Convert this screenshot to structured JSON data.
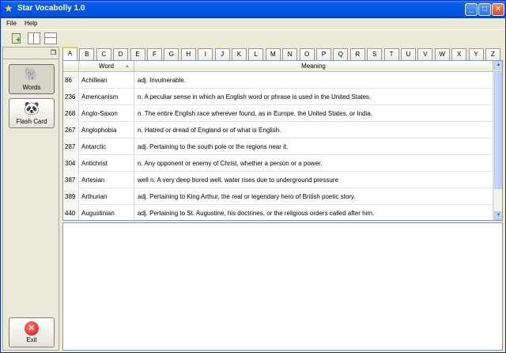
{
  "window": {
    "title": "Star Vocabolly 1.0"
  },
  "menu": {
    "file": "File",
    "help": "Help"
  },
  "sidebar": {
    "words_label": "Words",
    "flash_label": "Flash Card",
    "exit_label": "Exit"
  },
  "letters": [
    "A",
    "B",
    "C",
    "D",
    "E",
    "F",
    "G",
    "H",
    "I",
    "J",
    "K",
    "L",
    "M",
    "N",
    "O",
    "P",
    "Q",
    "R",
    "S",
    "T",
    "U",
    "V",
    "W",
    "X",
    "Y",
    "Z"
  ],
  "selected_letter": "A",
  "table": {
    "headers": {
      "num": "",
      "word": "Word",
      "meaning": "Meaning"
    },
    "rows": [
      {
        "num": "86",
        "word": "Achillean",
        "meaning": "adj. Invulnerable."
      },
      {
        "num": "236",
        "word": "Americanism",
        "meaning": "n. A peculiar sense in which an English word or phrase is used in the United States."
      },
      {
        "num": "268",
        "word": "Anglo-Saxon",
        "meaning": "n. The entire English race wherever found, as in Europe, the United States, or India."
      },
      {
        "num": "267",
        "word": "Anglophobia",
        "meaning": "n. Hatred or dread of England or of what is English."
      },
      {
        "num": "287",
        "word": "Antarctic",
        "meaning": "adj. Pertaining to the south pole or the regions near it."
      },
      {
        "num": "304",
        "word": "Antichrist",
        "meaning": "n. Any opponent or enemy of Christ, whether a person or a power."
      },
      {
        "num": "387",
        "word": "Artesian",
        "meaning": "well n. A very deep bored well. water rises due to underground pressure"
      },
      {
        "num": "389",
        "word": "Arthurian",
        "meaning": "adj. Pertaining to King Arthur, the real or legendary hero of British poetic story."
      },
      {
        "num": "440",
        "word": "Augustinian",
        "meaning": "adj. Pertaining to St. Augustine, his doctrines, or the religious orders called after him."
      }
    ]
  },
  "icons": {
    "title": "star-icon",
    "add": "add-word-icon",
    "split": "split-view-icon",
    "stack": "stacked-view-icon",
    "words": "elephant-icon",
    "flash": "panda-icon",
    "exit": "exit-icon"
  },
  "colors": {
    "titlebar": "#0058e6",
    "selected_tab": "#ffc83c",
    "exit": "#c8141a"
  }
}
